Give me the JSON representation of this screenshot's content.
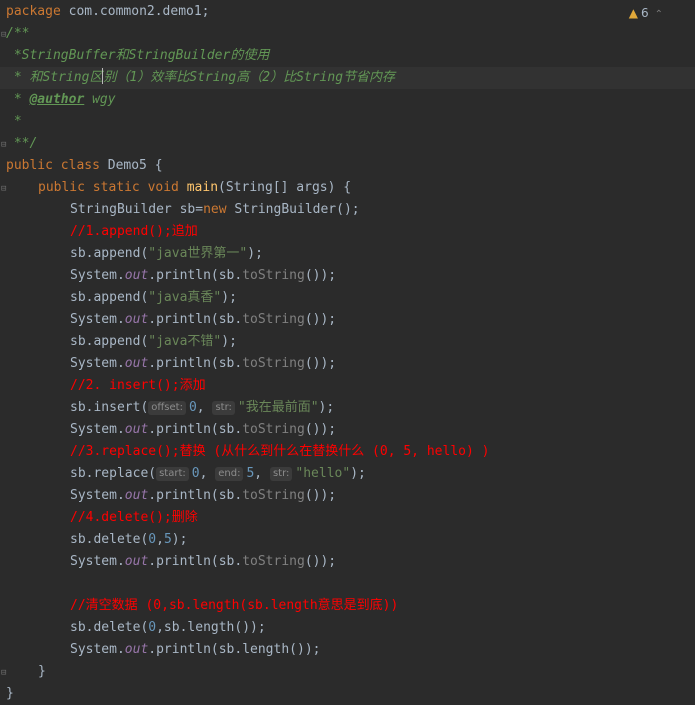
{
  "warnings": {
    "count": "6",
    "icon": "warning-triangle-icon",
    "arrow": "chevron-up-icon"
  },
  "code": {
    "package_kw": "package",
    "package_name": " com.common2.demo1;",
    "doc_open": "/**",
    "doc_line1": " *StringBuffer和StringBuilder的使用",
    "doc_line2_a": " * 和String区",
    "doc_line2_b": "别（1）效率比String高（2）比String节省内存",
    "doc_star": " * ",
    "doc_author_tag": "@author",
    "doc_author_name": " wgy",
    "doc_line4": " *",
    "doc_close": " **/",
    "class_kw": "public class",
    "class_name": " Demo5 {",
    "main_mods": "public static void ",
    "main_name": "main",
    "main_params": "(String[] args) {",
    "sb_decl_a": "StringBuilder sb=",
    "sb_decl_new": "new",
    "sb_decl_b": " StringBuilder();",
    "c1": "//1.append();追加",
    "app1_a": "sb.append(",
    "app1_s": "\"java世界第一\"",
    "app2_s": "\"java真香\"",
    "app3_s": "\"java不错\"",
    "close_paren": ");",
    "sys": "System.",
    "out": "out",
    "println_a": ".println(sb.",
    "tostr": "toString",
    "println_b": "());",
    "c2": "//2. insert();添加",
    "ins_a": "sb.insert(",
    "hint_offset": "offset:",
    "hint_str": "str:",
    "ins_num": "0",
    "comma": ", ",
    "ins_s": "\"我在最前面\"",
    "c3": "//3.replace();替换 (从什么到什么在替换什么 (0, 5, hello) )",
    "rep_a": "sb.replace(",
    "hint_start": "start:",
    "hint_end": "end:",
    "rep_start": "0",
    "rep_end": "5",
    "rep_s": "\"hello\"",
    "c4": "//4.delete();删除",
    "del_a": "sb.delete(",
    "del_0": "0",
    "del_comma": ",",
    "del_5": "5",
    "c5": "//清空数据 (0,sb.length(sb.length意思是到底))",
    "del2_b": ",sb.length());",
    "println_len": ".println(sb.length());",
    "brace_close": "}"
  }
}
